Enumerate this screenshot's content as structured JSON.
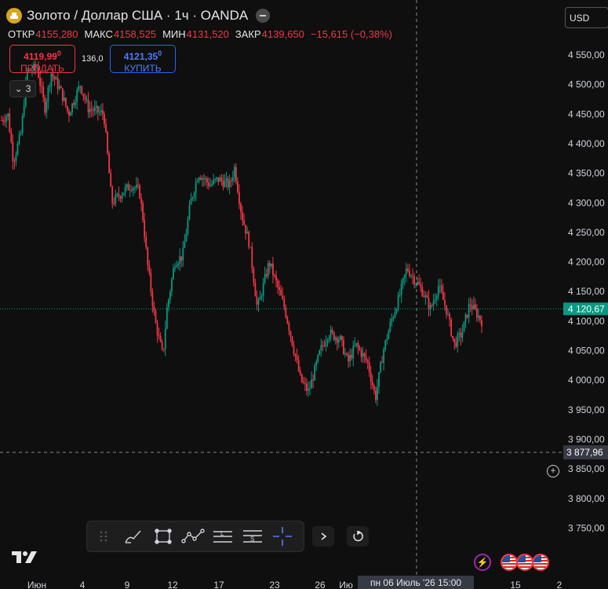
{
  "header": {
    "title": "Золото / Доллар США · 1ч · OANDA",
    "ohlc": [
      {
        "key": "ОТКР",
        "value": "4155,280"
      },
      {
        "key": "МАКС",
        "value": "4158,525"
      },
      {
        "key": "МИН",
        "value": "4131,520"
      },
      {
        "key": "ЗАКР",
        "value": "4139,650"
      }
    ],
    "change": "−15,615 (−0,38%)",
    "sell": {
      "price_main": "4119,99",
      "price_sup": "0",
      "label": "ПРОДАТЬ"
    },
    "buy": {
      "price_main": "4121,35",
      "price_sup": "0",
      "label": "КУПИТЬ"
    },
    "spread": "136,0",
    "indicators_count": "3"
  },
  "currency": "USD",
  "price_axis": {
    "ticks": [
      "4 550,00",
      "4 500,00",
      "4 450,00",
      "4 400,00",
      "4 350,00",
      "4 300,00",
      "4 250,00",
      "4 200,00",
      "4 150,00",
      "4 100,00",
      "4 050,00",
      "4 000,00",
      "3 950,00",
      "3 900,00",
      "3 850,00",
      "3 800,00",
      "3 750,00"
    ],
    "current_price_label": "4 120,67",
    "crosshair_price_label": "3 877,96"
  },
  "time_axis": {
    "ticks": [
      "Июн",
      "4",
      "9",
      "12",
      "17",
      "23",
      "26",
      "Ию",
      "15",
      "2"
    ],
    "crosshair_label": "пн 06 Июль '26   15:00"
  },
  "colors": {
    "up": "#089981",
    "down": "#f23645",
    "background": "#0f0f0f",
    "current_price": "#089981"
  },
  "chart_data": {
    "type": "candlestick",
    "title": "Золото / Доллар США · 1ч · OANDA",
    "xlabel": "",
    "ylabel": "",
    "ylim": [
      3720,
      4580
    ],
    "crosshair": {
      "price": 3877.96,
      "time": "пн 06 Июль '26 15:00"
    },
    "current_price": 4120.67,
    "path": [
      [
        0,
        4440
      ],
      [
        0.8,
        4450
      ],
      [
        1.5,
        4370
      ],
      [
        2.5,
        4420
      ],
      [
        3.2,
        4520
      ],
      [
        4.5,
        4530
      ],
      [
        5.5,
        4460
      ],
      [
        6.3,
        4520
      ],
      [
        7.5,
        4490
      ],
      [
        8.5,
        4450
      ],
      [
        10,
        4500
      ],
      [
        11,
        4460
      ],
      [
        13,
        4450
      ],
      [
        14,
        4300
      ],
      [
        15.5,
        4320
      ],
      [
        16.5,
        4330
      ],
      [
        17.5,
        4320
      ],
      [
        18,
        4270
      ],
      [
        18.5,
        4200
      ],
      [
        19.5,
        4100
      ],
      [
        20.5,
        4040
      ],
      [
        21,
        4120
      ],
      [
        22,
        4200
      ],
      [
        23,
        4210
      ],
      [
        24,
        4300
      ],
      [
        25,
        4350
      ],
      [
        26.5,
        4330
      ],
      [
        27.5,
        4340
      ],
      [
        29,
        4330
      ],
      [
        29.6,
        4360
      ],
      [
        30.5,
        4280
      ],
      [
        31.5,
        4230
      ],
      [
        32.5,
        4120
      ],
      [
        34,
        4200
      ],
      [
        35,
        4160
      ],
      [
        36,
        4120
      ],
      [
        37,
        4060
      ],
      [
        38,
        4000
      ],
      [
        39,
        3980
      ],
      [
        40.5,
        4050
      ],
      [
        41.5,
        4080
      ],
      [
        43,
        4070
      ],
      [
        44,
        4030
      ],
      [
        45,
        4060
      ],
      [
        46.5,
        4030
      ],
      [
        47.5,
        3970
      ],
      [
        48.5,
        4050
      ],
      [
        49.5,
        4100
      ],
      [
        50.5,
        4140
      ],
      [
        51.5,
        4190
      ],
      [
        52.5,
        4170
      ],
      [
        53.5,
        4150
      ],
      [
        54.5,
        4120
      ],
      [
        55.5,
        4160
      ],
      [
        56.5,
        4120
      ],
      [
        57.5,
        4060
      ],
      [
        58.5,
        4080
      ],
      [
        59.5,
        4130
      ],
      [
        60.5,
        4110
      ],
      [
        61,
        4100
      ]
    ]
  }
}
